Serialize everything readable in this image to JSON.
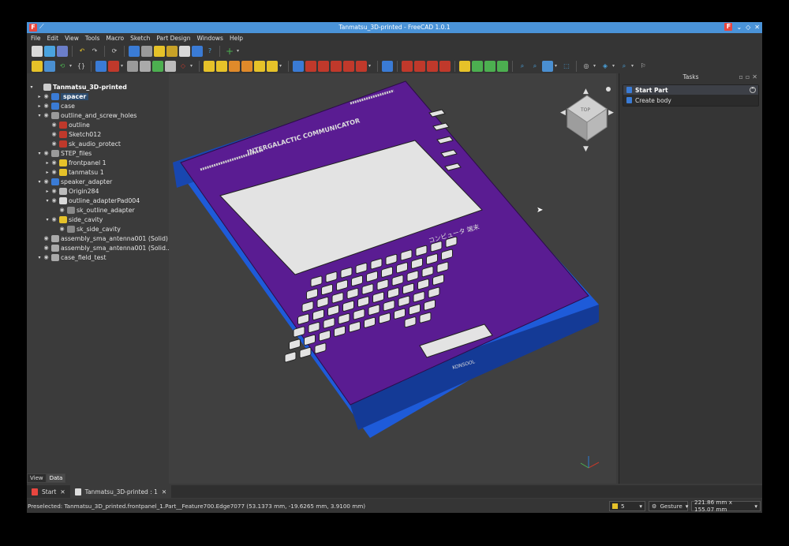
{
  "window": {
    "title": "Tanmatsu_3D-printed - FreeCAD 1.0.1"
  },
  "menu": [
    "File",
    "Edit",
    "View",
    "Tools",
    "Macro",
    "Sketch",
    "Part Design",
    "Windows",
    "Help"
  ],
  "tree": [
    {
      "label": "Tanmatsu_3D-printed",
      "indent": 0,
      "arrow": "▾",
      "bold": true,
      "eye": false,
      "icon": "document-icon",
      "color": "#cccccc"
    },
    {
      "label": "spacer",
      "indent": 1,
      "arrow": "▸",
      "bold": true,
      "sel": true,
      "eye": true,
      "icon": "body-icon",
      "color": "#3a7bd5"
    },
    {
      "label": "case",
      "indent": 1,
      "arrow": "▸",
      "eye": true,
      "icon": "body-icon",
      "color": "#3a7bd5"
    },
    {
      "label": "outline_and_screw_holes",
      "indent": 1,
      "arrow": "▾",
      "eye": true,
      "icon": "group-icon",
      "color": "#9a9a9a"
    },
    {
      "label": "outline",
      "indent": 2,
      "arrow": "",
      "eye": true,
      "icon": "sketch-icon",
      "color": "#c0392b"
    },
    {
      "label": "Sketch012",
      "indent": 2,
      "arrow": "",
      "eye": true,
      "icon": "sketch-icon",
      "color": "#c0392b"
    },
    {
      "label": "sk_audio_protect",
      "indent": 2,
      "arrow": "",
      "eye": true,
      "icon": "sketch-icon",
      "color": "#c0392b"
    },
    {
      "label": "STEP_files",
      "indent": 1,
      "arrow": "▾",
      "eye": true,
      "icon": "group-icon",
      "color": "#9a9a9a"
    },
    {
      "label": "frontpanel 1",
      "indent": 2,
      "arrow": "▸",
      "eye": true,
      "icon": "part-icon",
      "color": "#e6c229"
    },
    {
      "label": "tanmatsu 1",
      "indent": 2,
      "arrow": "▸",
      "eye": true,
      "icon": "part-icon",
      "color": "#e6c229"
    },
    {
      "label": "speaker_adapter",
      "indent": 1,
      "arrow": "▾",
      "eye": true,
      "icon": "body-icon",
      "color": "#3a7bd5"
    },
    {
      "label": "Origin284",
      "indent": 2,
      "arrow": "▸",
      "eye": true,
      "icon": "origin-icon",
      "color": "#bbbbbb"
    },
    {
      "label": "outline_adapterPad004",
      "indent": 2,
      "arrow": "▾",
      "eye": true,
      "icon": "pad-icon",
      "color": "#d9d9d9"
    },
    {
      "label": "sk_outline_adapter",
      "indent": 3,
      "arrow": "",
      "eye": true,
      "icon": "sketch-icon",
      "color": "#888888"
    },
    {
      "label": "side_cavity",
      "indent": 2,
      "arrow": "▾",
      "eye": true,
      "icon": "pocket-icon",
      "color": "#e6c229"
    },
    {
      "label": "sk_side_cavity",
      "indent": 3,
      "arrow": "",
      "eye": true,
      "icon": "sketch-icon",
      "color": "#888888"
    },
    {
      "label": "assembly_sma_antenna001 (Solid)",
      "indent": 1,
      "arrow": "",
      "eye": true,
      "icon": "solid-icon",
      "color": "#aaaaaa"
    },
    {
      "label": "assembly_sma_antenna001 (Solid...",
      "indent": 1,
      "arrow": "",
      "eye": true,
      "icon": "solid-icon",
      "color": "#aaaaaa"
    },
    {
      "label": "case_field_test",
      "indent": 1,
      "arrow": "▾",
      "eye": true,
      "icon": "feature-icon",
      "color": "#aaaaaa"
    }
  ],
  "combo_tabs": {
    "view": "View",
    "data": "Data"
  },
  "tasks": {
    "header": "Tasks",
    "panel_title": "Start Part",
    "action": "Create body"
  },
  "device": {
    "brand": "INTERGALACTIC COMMUNICATOR",
    "jp": "コンピュータ 端末",
    "logo": "KONSOOL"
  },
  "nav_cube": {
    "face": "TOP"
  },
  "doc_tabs": [
    "Start",
    "Tanmatsu_3D-printed : 1"
  ],
  "status": {
    "message": "Preselected: Tanmatsu_3D_printed.frontpanel_1.Part__Feature700.Edge7077 (53.1373 mm, -19.6265 mm, 3.9100 mm)",
    "count": "5",
    "nav_style": "Gesture",
    "dimensions": "221.86 mm x 155.07 mm"
  }
}
